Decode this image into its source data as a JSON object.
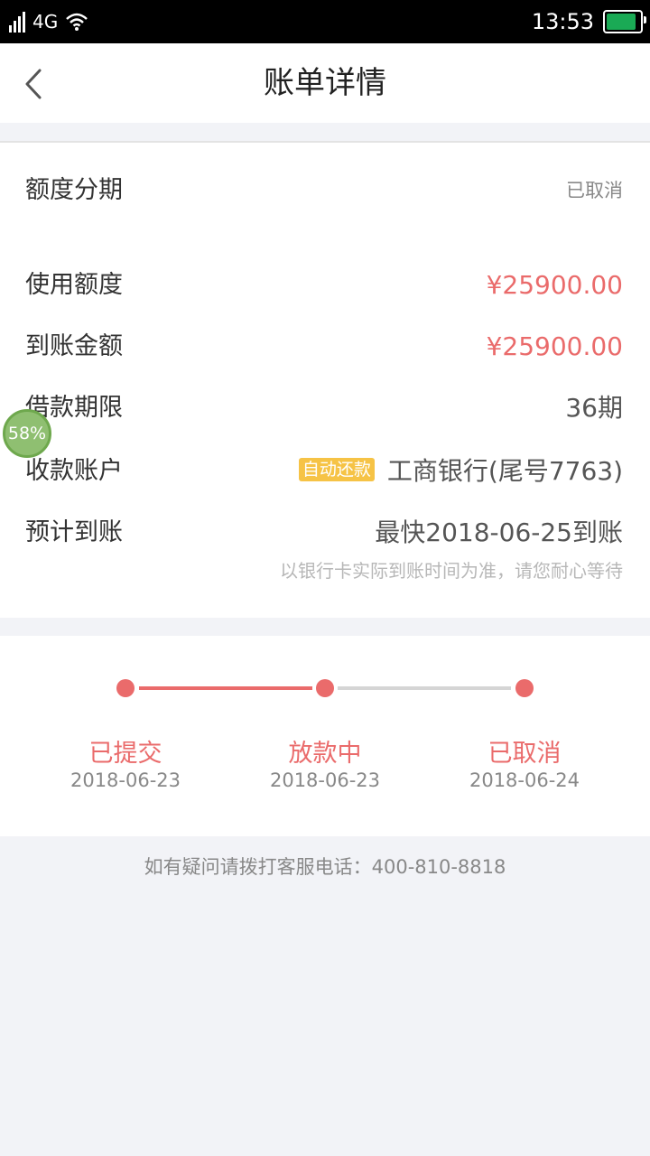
{
  "status_bar": {
    "sim_slot": "2",
    "network": "4G",
    "time": "13:53",
    "battery_color": "#1aaa55"
  },
  "header": {
    "back_icon": "chevron-left-icon",
    "title": "账单详情"
  },
  "loan_type": {
    "label": "额度分期",
    "status": "已取消"
  },
  "details": {
    "rows": [
      {
        "label": "使用额度",
        "value": "¥25900.00"
      },
      {
        "label": "到账金额",
        "value": "¥25900.00"
      },
      {
        "label": "借款期限",
        "value": "36期"
      },
      {
        "label": "收款账户",
        "badge": "自动还款",
        "value": "工商银行(尾号7763)"
      },
      {
        "label": "预计到账",
        "value": "最快2018-06-25到账"
      }
    ],
    "note": "以银行卡实际到账时间为准，请您耐心等待"
  },
  "progress": {
    "steps": [
      {
        "label": "已提交",
        "date": "2018-06-23"
      },
      {
        "label": "放款中",
        "date": "2018-06-23"
      },
      {
        "label": "已取消",
        "date": "2018-06-24"
      }
    ],
    "active_color": "#ea6b6b",
    "inactive_color": "#d5d5d5"
  },
  "footer": {
    "text": "如有疑问请拨打客服电话：400-810-8818"
  },
  "floating_widget": {
    "percent": "58%"
  },
  "colors": {
    "accent_red": "#ea6b6b",
    "badge_yellow": "#f6c346",
    "background": "#f2f3f7"
  }
}
